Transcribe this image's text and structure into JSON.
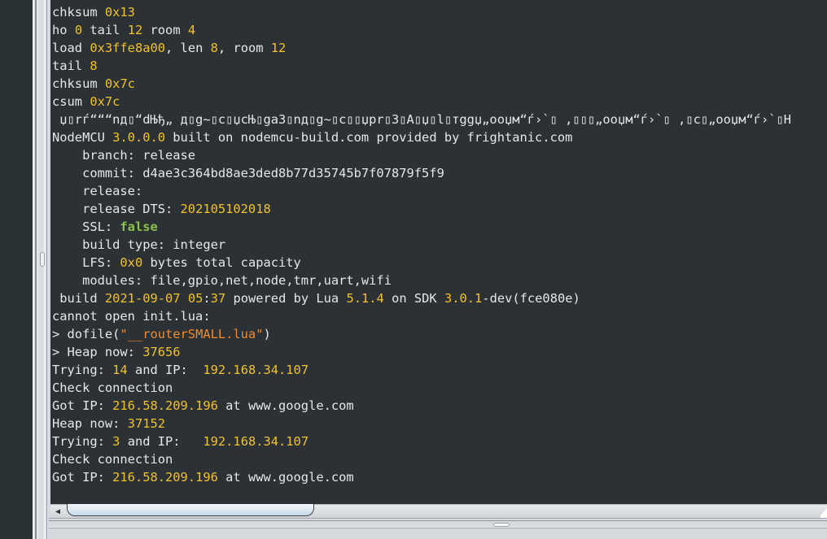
{
  "terminal": {
    "lines": [
      [
        {
          "t": "chksum "
        },
        {
          "t": "0x13",
          "c": "num"
        }
      ],
      [
        {
          "t": "ho "
        },
        {
          "t": "0",
          "c": "num"
        },
        {
          "t": " tail "
        },
        {
          "t": "12",
          "c": "num"
        },
        {
          "t": " room "
        },
        {
          "t": "4",
          "c": "num"
        }
      ],
      [
        {
          "t": "load "
        },
        {
          "t": "0x3ffe8a00",
          "c": "num"
        },
        {
          "t": ", len "
        },
        {
          "t": "8",
          "c": "num"
        },
        {
          "t": ", room "
        },
        {
          "t": "12",
          "c": "num"
        }
      ],
      [
        {
          "t": "tail "
        },
        {
          "t": "8",
          "c": "num"
        }
      ],
      [
        {
          "t": "chksum "
        },
        {
          "t": "0x7c",
          "c": "num"
        }
      ],
      [
        {
          "t": "csum "
        },
        {
          "t": "0x7c",
          "c": "num"
        }
      ],
      [
        {
          "t": " џ▯rѓ“““nд▯“dЊђ„ д▯g~▯c▯џcЊ▯ga3▯nд▯g~▯c▯▯џpr▯3▯A▯џ▯l▯тggџ„ooџм“ѓ›`▯ ,▯▯▯„ooџм“ѓ›`▯ ,▯c▯„ooџм“ѓ›`▯H"
        }
      ],
      [
        {
          "t": "NodeMCU "
        },
        {
          "t": "3.0.0.0",
          "c": "num"
        },
        {
          "t": " built on nodemcu-build.com provided by frightanic.com"
        }
      ],
      [
        {
          "t": "    branch: release"
        }
      ],
      [
        {
          "t": "    commit: d4ae3c364bd8ae3ded8b77d35745b7f07879f5f9"
        }
      ],
      [
        {
          "t": "    release:"
        }
      ],
      [
        {
          "t": "    release DTS: "
        },
        {
          "t": "202105102018",
          "c": "num"
        }
      ],
      [
        {
          "t": "    SSL: "
        },
        {
          "t": "false",
          "c": "kw"
        }
      ],
      [
        {
          "t": "    build type: integer"
        }
      ],
      [
        {
          "t": "    LFS: "
        },
        {
          "t": "0x0",
          "c": "num"
        },
        {
          "t": " bytes total capacity"
        }
      ],
      [
        {
          "t": "    modules: file,gpio,net,node,tmr,uart,wifi"
        }
      ],
      [
        {
          "t": " build "
        },
        {
          "t": "2021-09-07",
          "c": "num"
        },
        {
          "t": " "
        },
        {
          "t": "05",
          "c": "num"
        },
        {
          "t": ":"
        },
        {
          "t": "37",
          "c": "num"
        },
        {
          "t": " powered by Lua "
        },
        {
          "t": "5.1.4",
          "c": "num"
        },
        {
          "t": " on SDK "
        },
        {
          "t": "3.0.1",
          "c": "num"
        },
        {
          "t": "-dev(fce080e)"
        }
      ],
      [
        {
          "t": "cannot open init.lua:"
        }
      ],
      [
        {
          "t": "> dofile("
        },
        {
          "t": "\"__routerSMALL.lua\"",
          "c": "str"
        },
        {
          "t": ")"
        }
      ],
      [
        {
          "t": "> Heap now: "
        },
        {
          "t": "37656",
          "c": "num"
        }
      ],
      [
        {
          "t": "Trying: "
        },
        {
          "t": "14",
          "c": "num"
        },
        {
          "t": " and IP:  "
        },
        {
          "t": "192.168.34.107",
          "c": "num"
        }
      ],
      [
        {
          "t": "Check connection"
        }
      ],
      [
        {
          "t": "Got IP: "
        },
        {
          "t": "216.58.209.196",
          "c": "num"
        },
        {
          "t": " at www.google.com"
        }
      ],
      [
        {
          "t": "Heap now: "
        },
        {
          "t": "37152",
          "c": "num"
        }
      ],
      [
        {
          "t": "Trying: "
        },
        {
          "t": "3",
          "c": "num"
        },
        {
          "t": " and IP:   "
        },
        {
          "t": "192.168.34.107",
          "c": "num"
        }
      ],
      [
        {
          "t": "Check connection"
        }
      ],
      [
        {
          "t": "Got IP: "
        },
        {
          "t": "216.58.209.196",
          "c": "num"
        },
        {
          "t": " at www.google.com"
        }
      ]
    ]
  },
  "scrollbar": {
    "left_arrow_icon": "◀",
    "thumb_fraction": 0.32
  },
  "colors": {
    "terminal_bg": "#2b3134",
    "text": "#e6e8e8",
    "number": "#f2c12e",
    "keyword": "#8bc34a",
    "string": "#f28b2b"
  }
}
